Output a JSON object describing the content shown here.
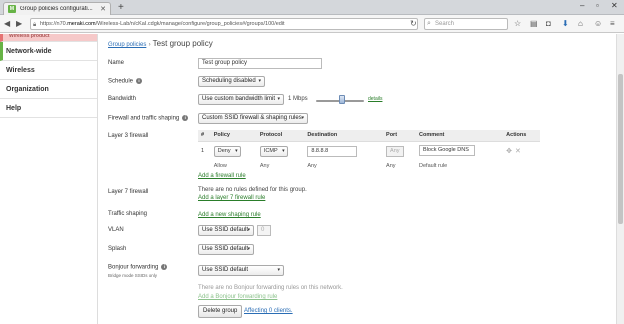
{
  "browser": {
    "tab_title": "Group policies configurati...",
    "tab_favicon": "M",
    "url_host": "https://n70.",
    "url_domain": "meraki.com",
    "url_path": "/Wireless-Lab/n/cKaI.cdgk/manage/configure/group_policies#/groups/100/edit",
    "search_placeholder": "Search"
  },
  "sidebar": {
    "items": [
      {
        "label": "Wireless product"
      },
      {
        "label": "Network-wide"
      },
      {
        "label": "Wireless"
      },
      {
        "label": "Organization"
      },
      {
        "label": "Help"
      }
    ]
  },
  "breadcrumb": {
    "parent": "Group policies",
    "separator": "›",
    "title": "Test group policy"
  },
  "form": {
    "name_label": "Name",
    "name_value": "Test group policy",
    "schedule_label": "Schedule",
    "schedule_value": "Scheduling disabled",
    "bandwidth_label": "Bandwidth",
    "bandwidth_value": "Use custom bandwidth limit",
    "bandwidth_rate": "1 Mbps",
    "bandwidth_slider_fraction": 0.55,
    "bandwidth_details_link": "details",
    "traffic_shaping_label": "Firewall and traffic shaping",
    "traffic_shaping_value": "Custom SSID firewall & shaping rules",
    "l3_label": "Layer 3 firewall",
    "l3_columns": [
      "#",
      "Policy",
      "Protocol",
      "Destination",
      "Port",
      "Comment",
      "Actions"
    ],
    "l3_rule": {
      "num": "1",
      "policy": "Deny",
      "protocol": "ICMP",
      "destination": "8.8.8.8",
      "port": "Any",
      "comment": "Block Google DNS"
    },
    "l3_default": {
      "policy": "Allow",
      "protocol": "Any",
      "destination": "Any",
      "port": "Any",
      "comment": "Default rule"
    },
    "l3_add_link": "Add a firewall rule",
    "l7_label": "Layer 7 firewall",
    "l7_empty": "There are no rules defined for this group.",
    "l7_add_link": "Add a layer 7 firewall rule",
    "shaping_label": "Traffic shaping",
    "shaping_add_link": "Add a new shaping rule",
    "vlan_label": "VLAN",
    "vlan_value": "Use SSID default",
    "vlan_number": "0",
    "splash_label": "Splash",
    "splash_value": "Use SSID default",
    "bonjour_label": "Bonjour forwarding",
    "bonjour_sub": "Bridge mode SSIDs only",
    "bonjour_value": "Use SSID default",
    "bonjour_empty": "There are no Bonjour forwarding rules on this network.",
    "bonjour_add_link": "Add a Bonjour forwarding rule",
    "delete_button": "Delete group",
    "affecting_link": "Affecting 0 clients."
  }
}
